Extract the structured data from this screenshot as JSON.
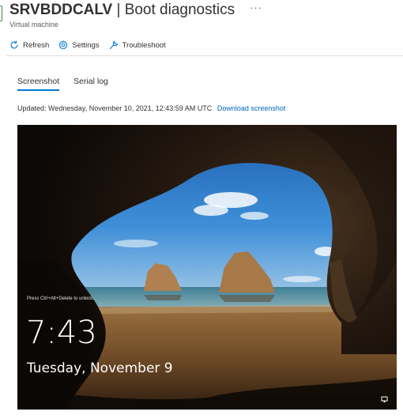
{
  "header": {
    "title_bold": "SRVBDDCALV",
    "title_rest": " | Boot diagnostics",
    "subtitle": "Virtual machine",
    "more_label": "···"
  },
  "toolbar": {
    "refresh_label": "Refresh",
    "settings_label": "Settings",
    "troubleshoot_label": "Troubleshoot"
  },
  "tabs": [
    {
      "label": "Screenshot",
      "active": true
    },
    {
      "label": "Serial log",
      "active": false
    }
  ],
  "updated": {
    "text": "Updated: Wednesday, November 10, 2021, 12:43:59 AM UTC",
    "download_label": "Download screenshot"
  },
  "lockscreen": {
    "hint": "Press Ctrl+Alt+Delete to unlock.",
    "time": "7:43",
    "date": "Tuesday, November 9"
  },
  "colors": {
    "accent": "#0078d4",
    "link": "#0066b8",
    "resource_icon": "#3a8a3a"
  }
}
